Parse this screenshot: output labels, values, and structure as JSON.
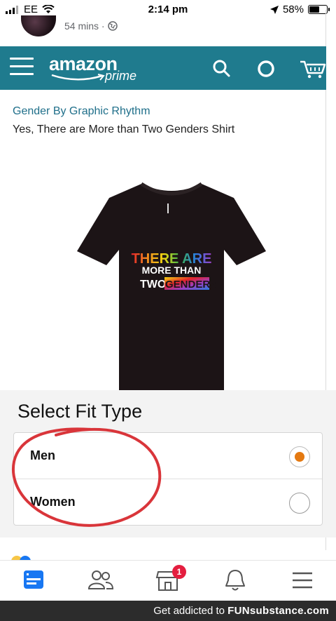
{
  "status_bar": {
    "carrier": "EE",
    "time": "2:14 pm",
    "battery": "58%",
    "battery_level": 0.58
  },
  "post": {
    "time_ago": "54 mins ·"
  },
  "amazon_header": {
    "logo_main": "amazon",
    "logo_sub": "prime",
    "icons": [
      "menu-icon",
      "search-icon",
      "alexa-icon",
      "cart-icon"
    ],
    "color": "#1f7b8e"
  },
  "product": {
    "brand_link": "Gender By Graphic Rhythm",
    "title": "Yes, There are More than Two Genders Shirt",
    "shirt_print": {
      "line1": "THERE ARE",
      "line2": "MORE THAN",
      "line3a": "TWO",
      "line3b": "GENDERS"
    }
  },
  "fit_selector": {
    "heading": "Select Fit Type",
    "options": [
      {
        "label": "Men",
        "selected": true
      },
      {
        "label": "Women",
        "selected": false
      }
    ],
    "accent": "#e47911"
  },
  "annotation": {
    "circle_color": "#d9353a"
  },
  "fb_nav": {
    "items": [
      "news-feed-icon",
      "friends-icon",
      "marketplace-icon",
      "notifications-icon",
      "menu-icon"
    ],
    "marketplace_badge": "1"
  },
  "watermark": {
    "prefix": "Get addicted to",
    "brand": "FUNsubstance.com"
  }
}
